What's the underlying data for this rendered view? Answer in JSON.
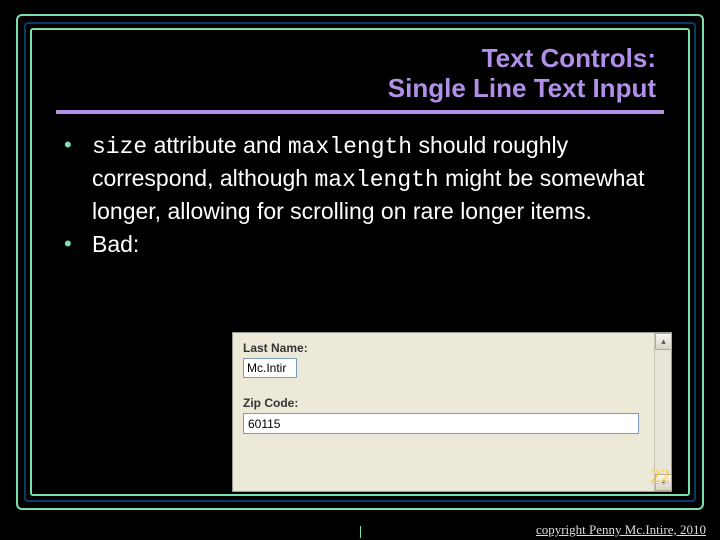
{
  "title": {
    "line1": "Text Controls:",
    "line2": "Single Line Text Input"
  },
  "bullets": {
    "b1_pre": "size",
    "b1_mid1": " attribute and ",
    "b1_m1": "maxlength",
    "b1_mid2": " should roughly correspond, although ",
    "b1_m2": "maxlength",
    "b1_post": " might be somewhat longer, allowing for scrolling on rare longer items.",
    "b2": "Bad:"
  },
  "form": {
    "last_name_label": "Last Name:",
    "last_name_value": "Mc.Intir",
    "zip_label": "Zip Code:",
    "zip_value": "60115"
  },
  "page_number": "22",
  "copyright": "copyright Penny Mc.Intire, 2010"
}
